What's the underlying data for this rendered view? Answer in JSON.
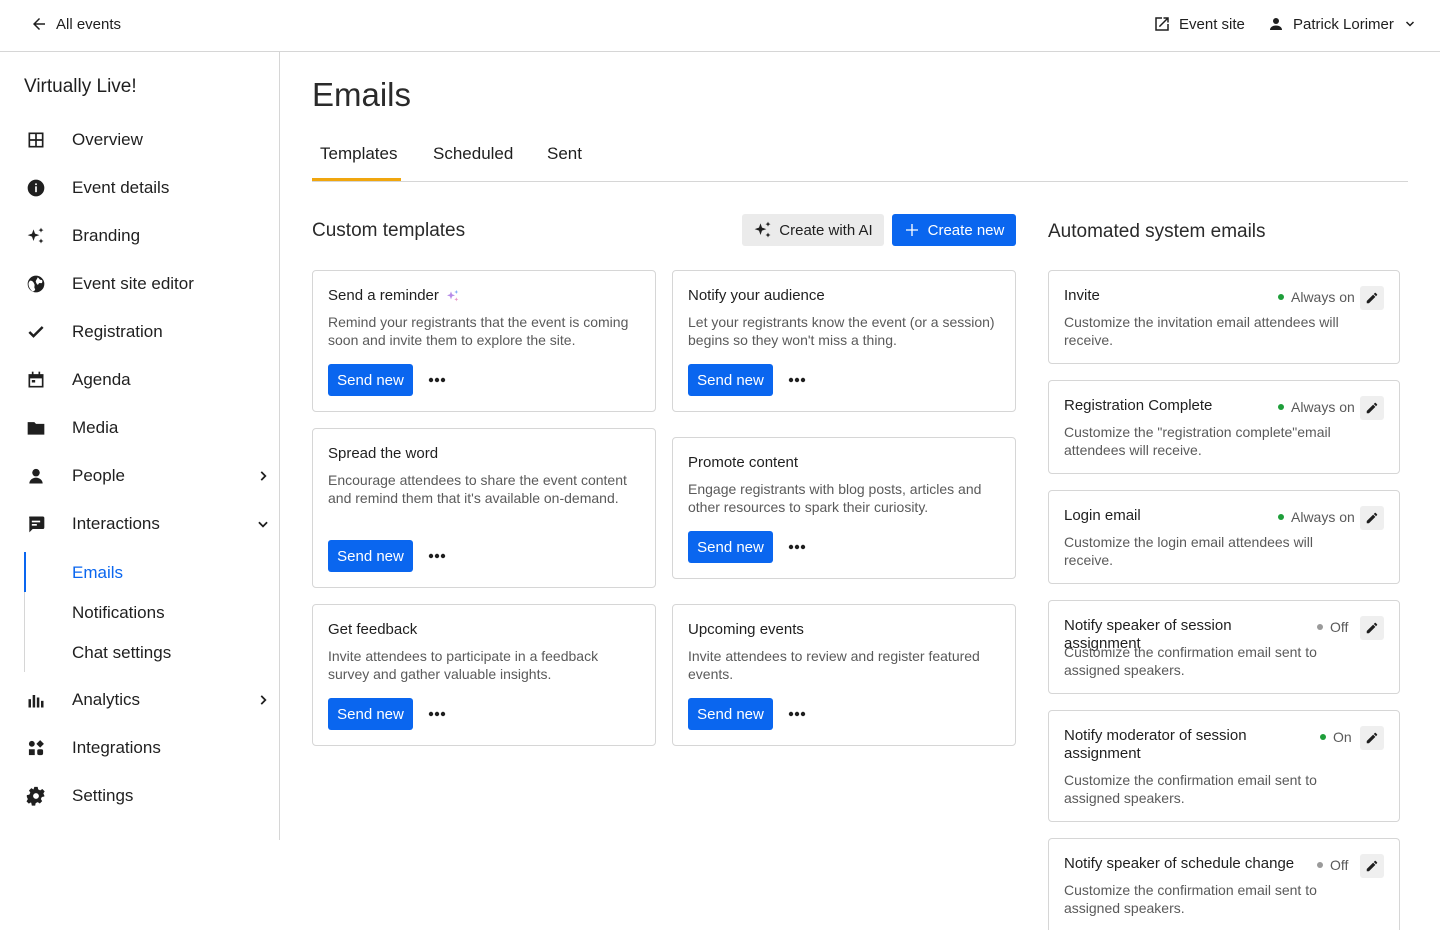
{
  "topbar": {
    "back_label": "All events",
    "event_site_label": "Event site",
    "user_name": "Patrick Lorimer"
  },
  "sidebar": {
    "app_name": "Virtually Live!",
    "items": [
      {
        "label": "Overview",
        "icon": "grid-icon"
      },
      {
        "label": "Event details",
        "icon": "info-icon"
      },
      {
        "label": "Branding",
        "icon": "sparkle-icon"
      },
      {
        "label": "Event site editor",
        "icon": "globe-icon"
      },
      {
        "label": "Registration",
        "icon": "checkmark-icon"
      },
      {
        "label": "Agenda",
        "icon": "calendar-icon"
      },
      {
        "label": "Media",
        "icon": "folder-icon"
      },
      {
        "label": "People",
        "icon": "person-icon"
      },
      {
        "label": "Interactions",
        "icon": "chat-icon"
      },
      {
        "label": "Analytics",
        "icon": "bar-chart-icon"
      },
      {
        "label": "Integrations",
        "icon": "integrations-icon"
      },
      {
        "label": "Settings",
        "icon": "gear-icon"
      }
    ],
    "sub_items": [
      {
        "label": "Emails",
        "active": true
      },
      {
        "label": "Notifications",
        "active": false
      },
      {
        "label": "Chat settings",
        "active": false
      }
    ]
  },
  "main": {
    "title": "Emails",
    "tabs": [
      {
        "label": "Templates",
        "active": true
      },
      {
        "label": "Scheduled",
        "active": false
      },
      {
        "label": "Sent",
        "active": false
      }
    ],
    "custom": {
      "title": "Custom templates",
      "create_ai_label": "Create with AI",
      "create_new_label": "Create new",
      "send_label": "Send new",
      "cards": [
        {
          "title": "Send a reminder",
          "ai": true,
          "desc": "Remind your registrants that the event is coming soon and invite them to explore the site."
        },
        {
          "title": "Notify your audience",
          "ai": false,
          "desc": "Let your registrants know the event (or a session) begins so they won't miss a thing."
        },
        {
          "title": "Spread the word",
          "ai": false,
          "desc": "Encourage attendees to share the event content and remind them that it's available on-demand."
        },
        {
          "title": "Promote content",
          "ai": false,
          "desc": "Engage registrants with blog posts, articles and other resources to spark their curiosity."
        },
        {
          "title": "Get feedback",
          "ai": false,
          "desc": "Invite attendees to participate in a feedback survey and gather valuable insights."
        },
        {
          "title": "Upcoming events",
          "ai": false,
          "desc": "Invite attendees to review and register featured events."
        }
      ]
    },
    "system": {
      "title": "Automated system emails",
      "cards": [
        {
          "title": "Invite",
          "status": "Always on",
          "status_color": "#1e9e3a",
          "desc": "Customize the invitation email attendees will receive."
        },
        {
          "title": "Registration Complete",
          "status": "Always on",
          "status_color": "#1e9e3a",
          "desc": "Customize the \"registration complete\"email attendees will receive."
        },
        {
          "title": "Login email",
          "status": "Always on",
          "status_color": "#1e9e3a",
          "desc": "Customize the login email attendees will receive."
        },
        {
          "title": "Notify speaker of session assignment",
          "status": "Off",
          "status_color": "#9a9a9a",
          "desc": "Customize the confirmation email sent to assigned speakers."
        },
        {
          "title": "Notify moderator of session assignment",
          "status": "On",
          "status_color": "#1e9e3a",
          "desc": "Customize the confirmation email sent to assigned speakers."
        },
        {
          "title": "Notify speaker of schedule change",
          "status": "Off",
          "status_color": "#9a9a9a",
          "desc": "Customize the confirmation email sent to assigned speakers."
        }
      ]
    }
  },
  "colors": {
    "accent": "#0a66ef",
    "tab_indicator": "#f0a60e",
    "status_on": "#1e9e3a",
    "status_off": "#9a9a9a"
  }
}
